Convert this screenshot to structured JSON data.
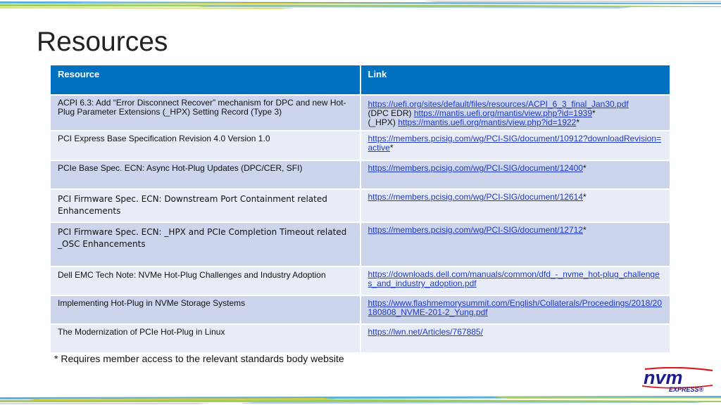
{
  "slide": {
    "title": "Resources",
    "footnote": "* Requires member access to the relevant standards body website"
  },
  "table": {
    "headers": [
      "Resource",
      "Link"
    ],
    "rows": [
      {
        "resource": "ACPI 6.3: Add “Error Disconnect Recover” mechanism for DPC and new Hot-Plug Parameter Extensions (_HPX) Setting Record (Type 3)",
        "link1": "https://uefi.org/sites/default/files/resources/ACPI_6_3_final_Jan30.pdf",
        "prefix2": "(DPC EDR) ",
        "link2": "https://mantis.uefi.org/mantis/view.php?id=1939",
        "suffix2": "*",
        "prefix3": "(_HPX) ",
        "link3": "https://mantis.uefi.org/mantis/view.php?id=1922",
        "suffix3": "*"
      },
      {
        "resource": "PCI Express Base Specification Revision 4.0 Version 1.0",
        "link": "https://members.pcisig.com/wg/PCI-SIG/document/10912?downloadRevision=active",
        "suffix": "*"
      },
      {
        "resource": "PCIe Base Spec. ECN: Async Hot-Plug Updates (DPC/CER, SFI)",
        "link": "https://members.pcisig.com/wg/PCI-SIG/document/12400",
        "suffix": "*"
      },
      {
        "resource": "PCI Firmware Spec. ECN: Downstream Port Containment related Enhancements",
        "link": "https://members.pcisig.com/wg/PCI-SIG/document/12614",
        "suffix": "*"
      },
      {
        "resource": "PCI Firmware Spec. ECN: _HPX and PCIe Completion Timeout related _OSC Enhancements",
        "link": "https://members.pcisig.com/wg/PCI-SIG/document/12712",
        "suffix": "*"
      },
      {
        "resource": "Dell EMC Tech Note: NVMe Hot-Plug Challenges and Industry Adoption",
        "link": "https://downloads.dell.com/manuals/common/dfd_-_nvme_hot-plug_challenges_and_industry_adoption.pdf",
        "suffix": ""
      },
      {
        "resource": "Implementing Hot-Plug in NVMe Storage Systems",
        "link": "https://www.flashmemorysummit.com/English/Collaterals/Proceedings/2018/20180808_NVME-201-2_Yung.pdf",
        "suffix": ""
      },
      {
        "resource": "The Modernization of PCIe Hot-Plug in Linux",
        "link": "https://lwn.net/Articles/767885/",
        "suffix": ""
      }
    ]
  },
  "logo": {
    "text": "nvm",
    "subtext": "EXPRESS®"
  },
  "colors": {
    "header": "#0070c0",
    "row_odd": "#ccd5eb",
    "row_even": "#e8ecf6",
    "link": "#1f39c9",
    "logo_blue": "#1b1b8c",
    "logo_red": "#d71920"
  }
}
